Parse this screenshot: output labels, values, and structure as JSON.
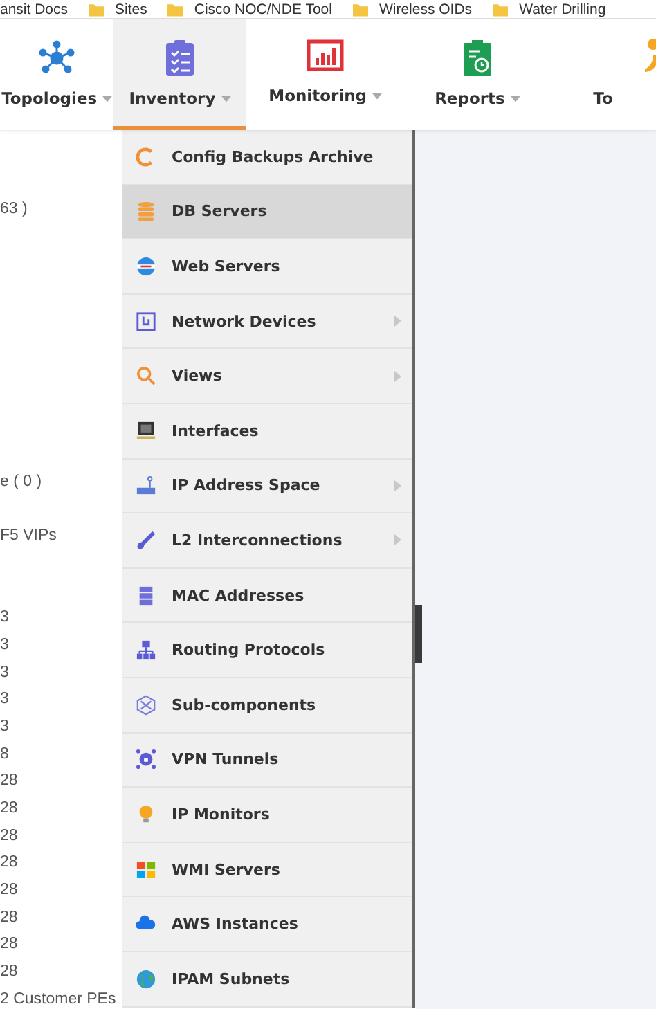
{
  "bookmarks": [
    "ansit Docs",
    "Sites",
    "Cisco NOC/NDE Tool",
    "Wireless OIDs",
    "Water  Drilling"
  ],
  "nav": [
    {
      "label": "Topologies",
      "selected": false
    },
    {
      "label": "Inventory",
      "selected": true
    },
    {
      "label": "Monitoring",
      "selected": false
    },
    {
      "label": "Reports",
      "selected": false
    },
    {
      "label": "To",
      "selected": false
    }
  ],
  "background_list": [
    "63 )",
    "e ( 0 )",
    "F5 VIPs",
    "3",
    "3",
    "3",
    "3",
    "3",
    "8",
    "28",
    "28",
    "28",
    "28",
    "28",
    "28",
    "28",
    "28",
    "2   Customer PEs"
  ],
  "menu": [
    {
      "label": "Config Backups Archive",
      "has_submenu": false,
      "selected": false
    },
    {
      "label": "DB Servers",
      "has_submenu": false,
      "selected": true
    },
    {
      "label": "Web Servers",
      "has_submenu": false,
      "selected": false
    },
    {
      "label": "Network Devices",
      "has_submenu": true,
      "selected": false
    },
    {
      "label": "Views",
      "has_submenu": true,
      "selected": false
    },
    {
      "label": "Interfaces",
      "has_submenu": false,
      "selected": false
    },
    {
      "label": "IP Address Space",
      "has_submenu": true,
      "selected": false
    },
    {
      "label": "L2 Interconnections",
      "has_submenu": true,
      "selected": false
    },
    {
      "label": "MAC Addresses",
      "has_submenu": false,
      "selected": false
    },
    {
      "label": "Routing Protocols",
      "has_submenu": false,
      "selected": false
    },
    {
      "label": "Sub-components",
      "has_submenu": false,
      "selected": false
    },
    {
      "label": "VPN Tunnels",
      "has_submenu": false,
      "selected": false
    },
    {
      "label": "IP Monitors",
      "has_submenu": false,
      "selected": false
    },
    {
      "label": "WMI Servers",
      "has_submenu": false,
      "selected": false
    },
    {
      "label": "AWS Instances",
      "has_submenu": false,
      "selected": false
    },
    {
      "label": "IPAM Subnets",
      "has_submenu": false,
      "selected": false
    }
  ]
}
